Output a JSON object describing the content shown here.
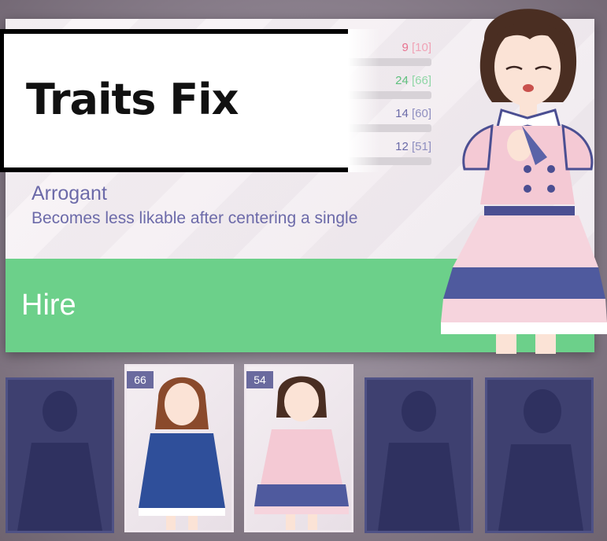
{
  "overlay": {
    "title": "Traits Fix"
  },
  "stats": [
    {
      "value": "9",
      "max": "[10]",
      "color": "#e8718f",
      "fill": 0.05
    },
    {
      "value": "24",
      "max": "[66]",
      "color": "#6cd08a",
      "fill": 0.36
    },
    {
      "value": "14",
      "max": "[60]",
      "color": "#6a6aa8",
      "fill": 0.23
    },
    {
      "value": "12",
      "max": "[51]",
      "color": "#6a6aa8",
      "fill": 0.2
    }
  ],
  "trait": {
    "name": "Arrogant",
    "description": "Becomes less likable after centering a single"
  },
  "hire": {
    "label": "Hire"
  },
  "cards": [
    {
      "type": "locked"
    },
    {
      "type": "owned",
      "number": "66"
    },
    {
      "type": "owned",
      "number": "54"
    },
    {
      "type": "locked"
    },
    {
      "type": "locked"
    }
  ],
  "colors": {
    "accent_green": "#6cd08a",
    "accent_purple": "#6c6aa9",
    "locked_card": "#3e4070"
  }
}
